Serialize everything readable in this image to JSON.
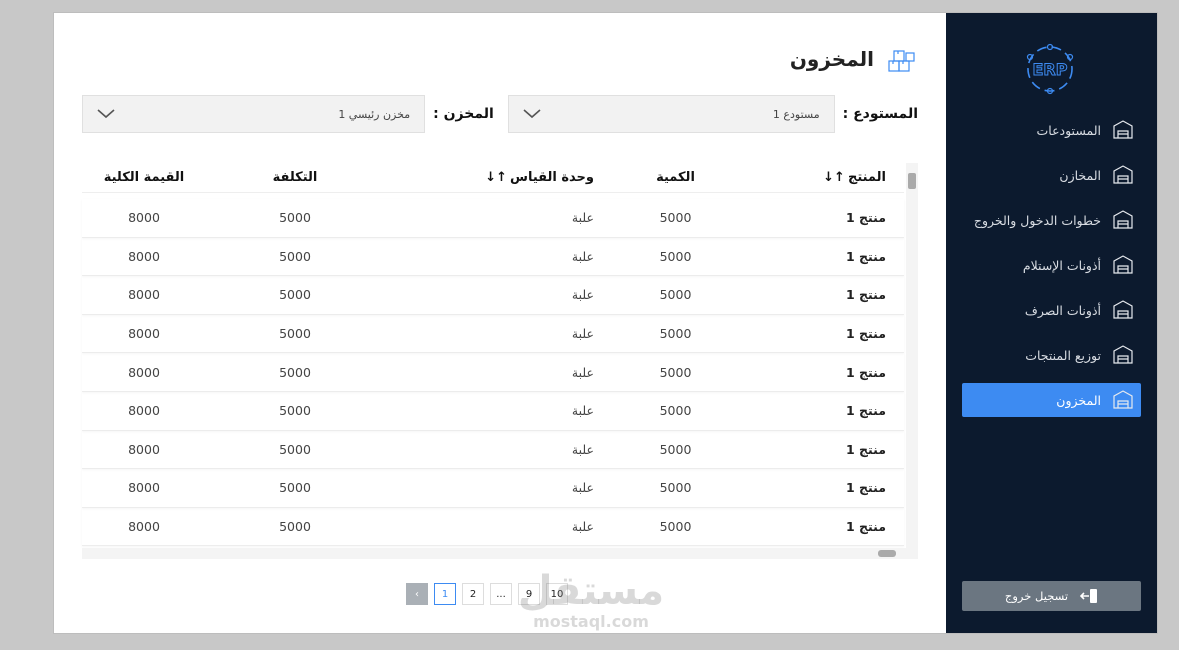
{
  "sidebar": {
    "logo": "ERP",
    "items": [
      {
        "label": "المستودعات",
        "icon": "warehouse-icon"
      },
      {
        "label": "المخازن",
        "icon": "building-icon"
      },
      {
        "label": "خطوات الدخول والخروج",
        "icon": "flow-icon"
      },
      {
        "label": "أذونات الإستلام",
        "icon": "receipt-doc-icon"
      },
      {
        "label": "أذونات الصرف",
        "icon": "issue-doc-icon"
      },
      {
        "label": "توزيع المنتجات",
        "icon": "distribution-icon"
      },
      {
        "label": "المخزون",
        "icon": "boxes-icon",
        "active": true
      }
    ],
    "logout_label": "تسجيل خروج"
  },
  "header": {
    "title": "المخزون"
  },
  "filters": {
    "warehouse_label": "المستودع :",
    "warehouse_value": "مستودع 1",
    "store_label": "المخزن :",
    "store_value": "مخزن رئيسي 1"
  },
  "table": {
    "columns": [
      "المنتج",
      "الكمية",
      "وحدة القياس",
      "التكلفة",
      "القيمة الكلية"
    ],
    "rows": [
      [
        "منتج 1",
        "5000",
        "علبة",
        "5000",
        "8000"
      ],
      [
        "منتج 1",
        "5000",
        "علبة",
        "5000",
        "8000"
      ],
      [
        "منتج 1",
        "5000",
        "علبة",
        "5000",
        "8000"
      ],
      [
        "منتج 1",
        "5000",
        "علبة",
        "5000",
        "8000"
      ],
      [
        "منتج 1",
        "5000",
        "علبة",
        "5000",
        "8000"
      ],
      [
        "منتج 1",
        "5000",
        "علبة",
        "5000",
        "8000"
      ],
      [
        "منتج 1",
        "5000",
        "علبة",
        "5000",
        "8000"
      ],
      [
        "منتج 1",
        "5000",
        "علبة",
        "5000",
        "8000"
      ],
      [
        "منتج 1",
        "5000",
        "علبة",
        "5000",
        "8000"
      ]
    ]
  },
  "pagination": {
    "pages": [
      "1",
      "2",
      "...",
      "9",
      "10"
    ],
    "current": "1"
  },
  "watermark": {
    "ar": "مستقل",
    "en": "mostaql.com"
  },
  "colors": {
    "sidebar": "#0c1a2e",
    "accent": "#3d8bf2",
    "logout": "#6b7681"
  }
}
